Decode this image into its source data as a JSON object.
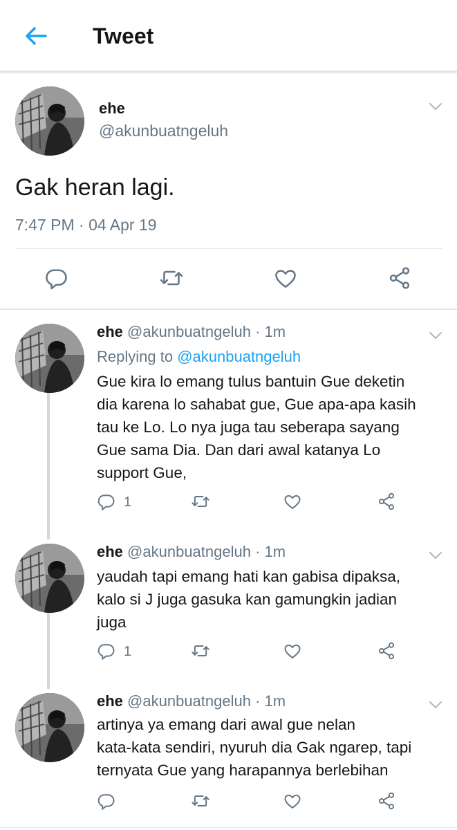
{
  "header": {
    "title": "Tweet"
  },
  "main_tweet": {
    "name": "ehe",
    "handle": "@akunbuatngeluh",
    "text": "Gak heran lagi.",
    "timestamp": "7:47 PM · 04 Apr 19"
  },
  "replies": [
    {
      "name": "ehe",
      "handle": "@akunbuatngeluh",
      "time": "· 1m",
      "replying_prefix": "Replying to",
      "replying_handle": "@akunbuatngeluh",
      "lines": [
        "Gue kira lo emang tulus bantuin Gue deketin",
        "dia karena lo sahabat gue, Gue apa-apa kasih",
        "tau ke Lo. Lo nya juga tau seberapa sayang",
        "Gue sama Dia. Dan dari awal katanya Lo",
        "support Gue,"
      ],
      "reply_count": "1"
    },
    {
      "name": "ehe",
      "handle": "@akunbuatngeluh",
      "time": "· 1m",
      "lines": [
        "yaudah tapi emang hati kan gabisa dipaksa,",
        "kalo si J juga gasuka kan gamungkin jadian",
        "juga"
      ],
      "reply_count": "1"
    },
    {
      "name": "ehe",
      "handle": "@akunbuatngeluh",
      "time": "· 1m",
      "lines": [
        "artinya ya emang dari awal gue nelan",
        "kata-kata sendiri, nyuruh dia Gak ngarep, tapi",
        "ternyata Gue yang harapannya berlebihan"
      ],
      "reply_count": ""
    }
  ],
  "colors": {
    "accent": "#1da1f2",
    "muted": "#657786",
    "text": "#14171a"
  },
  "icons": [
    "back-arrow-icon",
    "chevron-down-icon",
    "reply-icon",
    "retweet-icon",
    "like-icon",
    "share-icon"
  ]
}
